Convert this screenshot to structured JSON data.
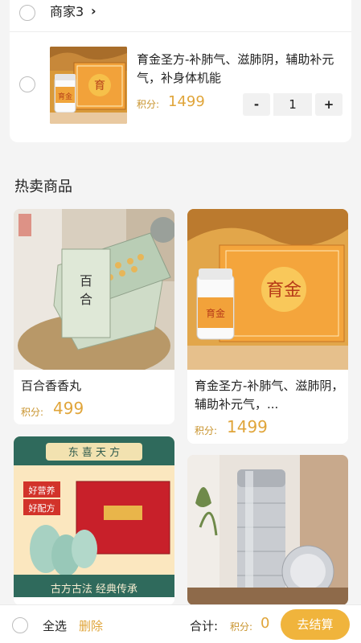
{
  "cart": {
    "store_name": "商家3",
    "store_chevron": "›",
    "item": {
      "title": "育金圣方-补肺气、滋肺阴，辅助补元气，补身体机能",
      "points_label": "积分:",
      "points_value": "1499",
      "qty": "1",
      "minus": "-",
      "plus": "+"
    }
  },
  "hot": {
    "title": "热卖商品",
    "products": [
      {
        "name": "百合香香丸",
        "points_label": "积分:",
        "points_value": "499"
      },
      {
        "name": "育金圣方-补肺气、滋肺阴，辅助补元气，...",
        "points_label": "积分:",
        "points_value": "1499"
      },
      {
        "banner_top": "东 喜 天 方",
        "tag_a": "好营养",
        "tag_b": "好配方",
        "banner_bottom": "古方古法  经典传承"
      },
      {}
    ]
  },
  "bottom": {
    "select_all": "全选",
    "delete": "删除",
    "total_label": "合计:",
    "points_label": "积分:",
    "points_value": "0",
    "checkout": "去结算"
  },
  "colors": {
    "accent": "#e0a53a",
    "checkout_bg": "#f0b43c"
  }
}
